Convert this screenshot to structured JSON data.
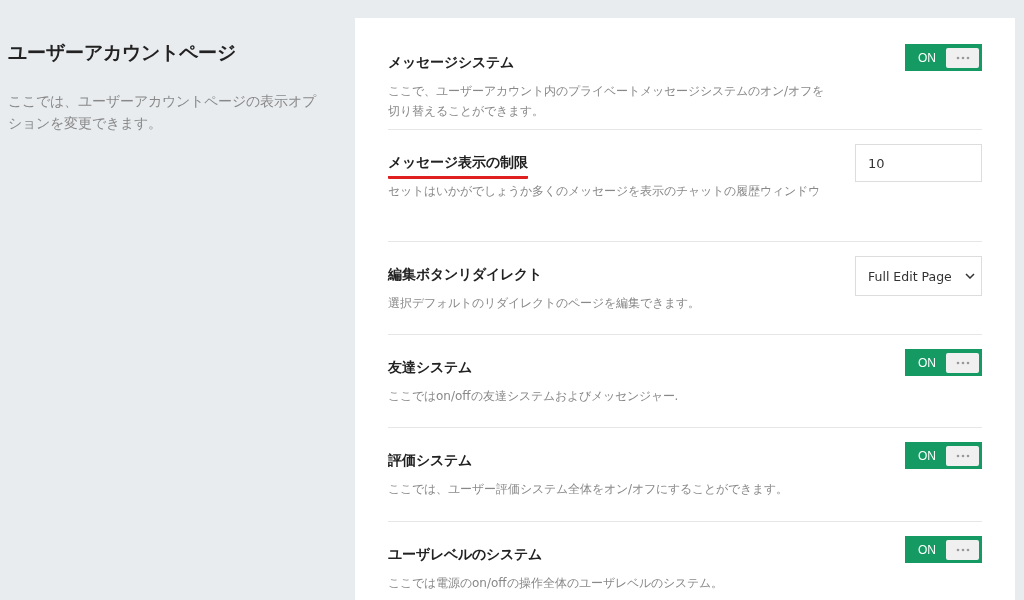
{
  "section": {
    "title": "ユーザーアカウントページ",
    "description": "ここでは、ユーザーアカウントページの表示オプションを変更できます。"
  },
  "settings": [
    {
      "kind": "toggle",
      "label": "メッセージシステム",
      "description": "ここで、ユーザーアカウント内のプライベートメッセージシステムのオン/オフを切り替えることができます。",
      "on": true,
      "on_text": "ON",
      "underlined": false
    },
    {
      "kind": "number",
      "label": "メッセージ表示の制限",
      "description": "セットはいかがでしょうか多くのメッセージを表示のチャットの履歴ウィンドウ",
      "value": "10",
      "underlined": true
    },
    {
      "kind": "select",
      "label": "編集ボタンリダイレクト",
      "description": "選択デフォルトのリダイレクトのページを編集できます。",
      "value": "Full Edit Page",
      "underlined": false
    },
    {
      "kind": "toggle",
      "label": "友達システム",
      "description": "ここではon/offの友達システムおよびメッセンジャー.",
      "on": true,
      "on_text": "ON",
      "underlined": false
    },
    {
      "kind": "toggle",
      "label": "評価システム",
      "description": "ここでは、ユーザー評価システム全体をオン/オフにすることができます。",
      "on": true,
      "on_text": "ON",
      "underlined": false
    },
    {
      "kind": "toggle",
      "label": "ユーザレベルのシステム",
      "description": "ここでは電源のon/offの操作全体のユーザレベルのシステム。",
      "on": true,
      "on_text": "ON",
      "underlined": false
    }
  ]
}
